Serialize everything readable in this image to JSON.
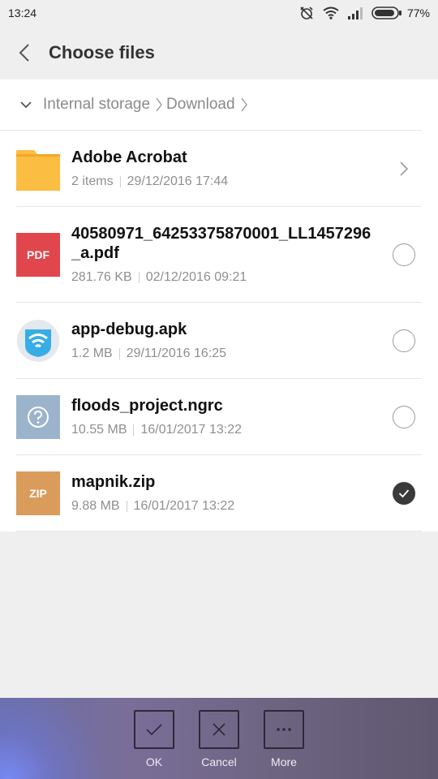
{
  "status_bar": {
    "time": "13:24",
    "battery_percent": "77%"
  },
  "header": {
    "title": "Choose files"
  },
  "breadcrumb": {
    "items": [
      "Internal storage",
      "Download"
    ]
  },
  "files": [
    {
      "name": "Adobe Acrobat",
      "meta_a": "2 items",
      "meta_b": "29/12/2016 17:44",
      "type": "folder",
      "icon": "folder-icon",
      "selected": false
    },
    {
      "name": "40580971_64253375870001_LL1457296_a.pdf",
      "meta_a": "281.76 KB",
      "meta_b": "02/12/2016 09:21",
      "type": "pdf",
      "icon": "pdf-file-icon",
      "icon_label": "PDF",
      "selected": false
    },
    {
      "name": "app-debug.apk",
      "meta_a": "1.2 MB",
      "meta_b": "29/11/2016 16:25",
      "type": "apk",
      "icon": "wifi-app-icon",
      "selected": false
    },
    {
      "name": "floods_project.ngrc",
      "meta_a": "10.55 MB",
      "meta_b": "16/01/2017 13:22",
      "type": "unknown",
      "icon": "unknown-file-icon",
      "selected": false
    },
    {
      "name": "mapnik.zip",
      "meta_a": "9.88 MB",
      "meta_b": "16/01/2017 13:22",
      "type": "zip",
      "icon": "zip-file-icon",
      "icon_label": "ZIP",
      "selected": true
    }
  ],
  "bottom_actions": {
    "ok": "OK",
    "cancel": "Cancel",
    "more": "More"
  },
  "colors": {
    "folder": "#fbbd42",
    "pdf": "#e2464d",
    "apk_bg": "#e4e8ef",
    "apk": "#36aee5",
    "unknown": "#9bb4cc",
    "zip": "#d99c5a"
  }
}
